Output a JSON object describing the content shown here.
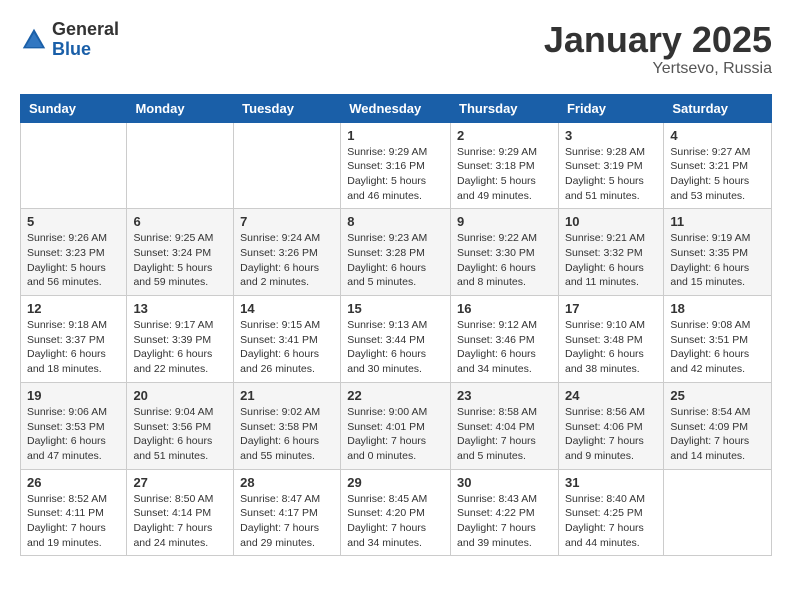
{
  "header": {
    "logo_general": "General",
    "logo_blue": "Blue",
    "month_title": "January 2025",
    "location": "Yertsevo, Russia"
  },
  "weekdays": [
    "Sunday",
    "Monday",
    "Tuesday",
    "Wednesday",
    "Thursday",
    "Friday",
    "Saturday"
  ],
  "weeks": [
    [
      {
        "day": "",
        "info": ""
      },
      {
        "day": "",
        "info": ""
      },
      {
        "day": "",
        "info": ""
      },
      {
        "day": "1",
        "info": "Sunrise: 9:29 AM\nSunset: 3:16 PM\nDaylight: 5 hours\nand 46 minutes."
      },
      {
        "day": "2",
        "info": "Sunrise: 9:29 AM\nSunset: 3:18 PM\nDaylight: 5 hours\nand 49 minutes."
      },
      {
        "day": "3",
        "info": "Sunrise: 9:28 AM\nSunset: 3:19 PM\nDaylight: 5 hours\nand 51 minutes."
      },
      {
        "day": "4",
        "info": "Sunrise: 9:27 AM\nSunset: 3:21 PM\nDaylight: 5 hours\nand 53 minutes."
      }
    ],
    [
      {
        "day": "5",
        "info": "Sunrise: 9:26 AM\nSunset: 3:23 PM\nDaylight: 5 hours\nand 56 minutes."
      },
      {
        "day": "6",
        "info": "Sunrise: 9:25 AM\nSunset: 3:24 PM\nDaylight: 5 hours\nand 59 minutes."
      },
      {
        "day": "7",
        "info": "Sunrise: 9:24 AM\nSunset: 3:26 PM\nDaylight: 6 hours\nand 2 minutes."
      },
      {
        "day": "8",
        "info": "Sunrise: 9:23 AM\nSunset: 3:28 PM\nDaylight: 6 hours\nand 5 minutes."
      },
      {
        "day": "9",
        "info": "Sunrise: 9:22 AM\nSunset: 3:30 PM\nDaylight: 6 hours\nand 8 minutes."
      },
      {
        "day": "10",
        "info": "Sunrise: 9:21 AM\nSunset: 3:32 PM\nDaylight: 6 hours\nand 11 minutes."
      },
      {
        "day": "11",
        "info": "Sunrise: 9:19 AM\nSunset: 3:35 PM\nDaylight: 6 hours\nand 15 minutes."
      }
    ],
    [
      {
        "day": "12",
        "info": "Sunrise: 9:18 AM\nSunset: 3:37 PM\nDaylight: 6 hours\nand 18 minutes."
      },
      {
        "day": "13",
        "info": "Sunrise: 9:17 AM\nSunset: 3:39 PM\nDaylight: 6 hours\nand 22 minutes."
      },
      {
        "day": "14",
        "info": "Sunrise: 9:15 AM\nSunset: 3:41 PM\nDaylight: 6 hours\nand 26 minutes."
      },
      {
        "day": "15",
        "info": "Sunrise: 9:13 AM\nSunset: 3:44 PM\nDaylight: 6 hours\nand 30 minutes."
      },
      {
        "day": "16",
        "info": "Sunrise: 9:12 AM\nSunset: 3:46 PM\nDaylight: 6 hours\nand 34 minutes."
      },
      {
        "day": "17",
        "info": "Sunrise: 9:10 AM\nSunset: 3:48 PM\nDaylight: 6 hours\nand 38 minutes."
      },
      {
        "day": "18",
        "info": "Sunrise: 9:08 AM\nSunset: 3:51 PM\nDaylight: 6 hours\nand 42 minutes."
      }
    ],
    [
      {
        "day": "19",
        "info": "Sunrise: 9:06 AM\nSunset: 3:53 PM\nDaylight: 6 hours\nand 47 minutes."
      },
      {
        "day": "20",
        "info": "Sunrise: 9:04 AM\nSunset: 3:56 PM\nDaylight: 6 hours\nand 51 minutes."
      },
      {
        "day": "21",
        "info": "Sunrise: 9:02 AM\nSunset: 3:58 PM\nDaylight: 6 hours\nand 55 minutes."
      },
      {
        "day": "22",
        "info": "Sunrise: 9:00 AM\nSunset: 4:01 PM\nDaylight: 7 hours\nand 0 minutes."
      },
      {
        "day": "23",
        "info": "Sunrise: 8:58 AM\nSunset: 4:04 PM\nDaylight: 7 hours\nand 5 minutes."
      },
      {
        "day": "24",
        "info": "Sunrise: 8:56 AM\nSunset: 4:06 PM\nDaylight: 7 hours\nand 9 minutes."
      },
      {
        "day": "25",
        "info": "Sunrise: 8:54 AM\nSunset: 4:09 PM\nDaylight: 7 hours\nand 14 minutes."
      }
    ],
    [
      {
        "day": "26",
        "info": "Sunrise: 8:52 AM\nSunset: 4:11 PM\nDaylight: 7 hours\nand 19 minutes."
      },
      {
        "day": "27",
        "info": "Sunrise: 8:50 AM\nSunset: 4:14 PM\nDaylight: 7 hours\nand 24 minutes."
      },
      {
        "day": "28",
        "info": "Sunrise: 8:47 AM\nSunset: 4:17 PM\nDaylight: 7 hours\nand 29 minutes."
      },
      {
        "day": "29",
        "info": "Sunrise: 8:45 AM\nSunset: 4:20 PM\nDaylight: 7 hours\nand 34 minutes."
      },
      {
        "day": "30",
        "info": "Sunrise: 8:43 AM\nSunset: 4:22 PM\nDaylight: 7 hours\nand 39 minutes."
      },
      {
        "day": "31",
        "info": "Sunrise: 8:40 AM\nSunset: 4:25 PM\nDaylight: 7 hours\nand 44 minutes."
      },
      {
        "day": "",
        "info": ""
      }
    ]
  ]
}
